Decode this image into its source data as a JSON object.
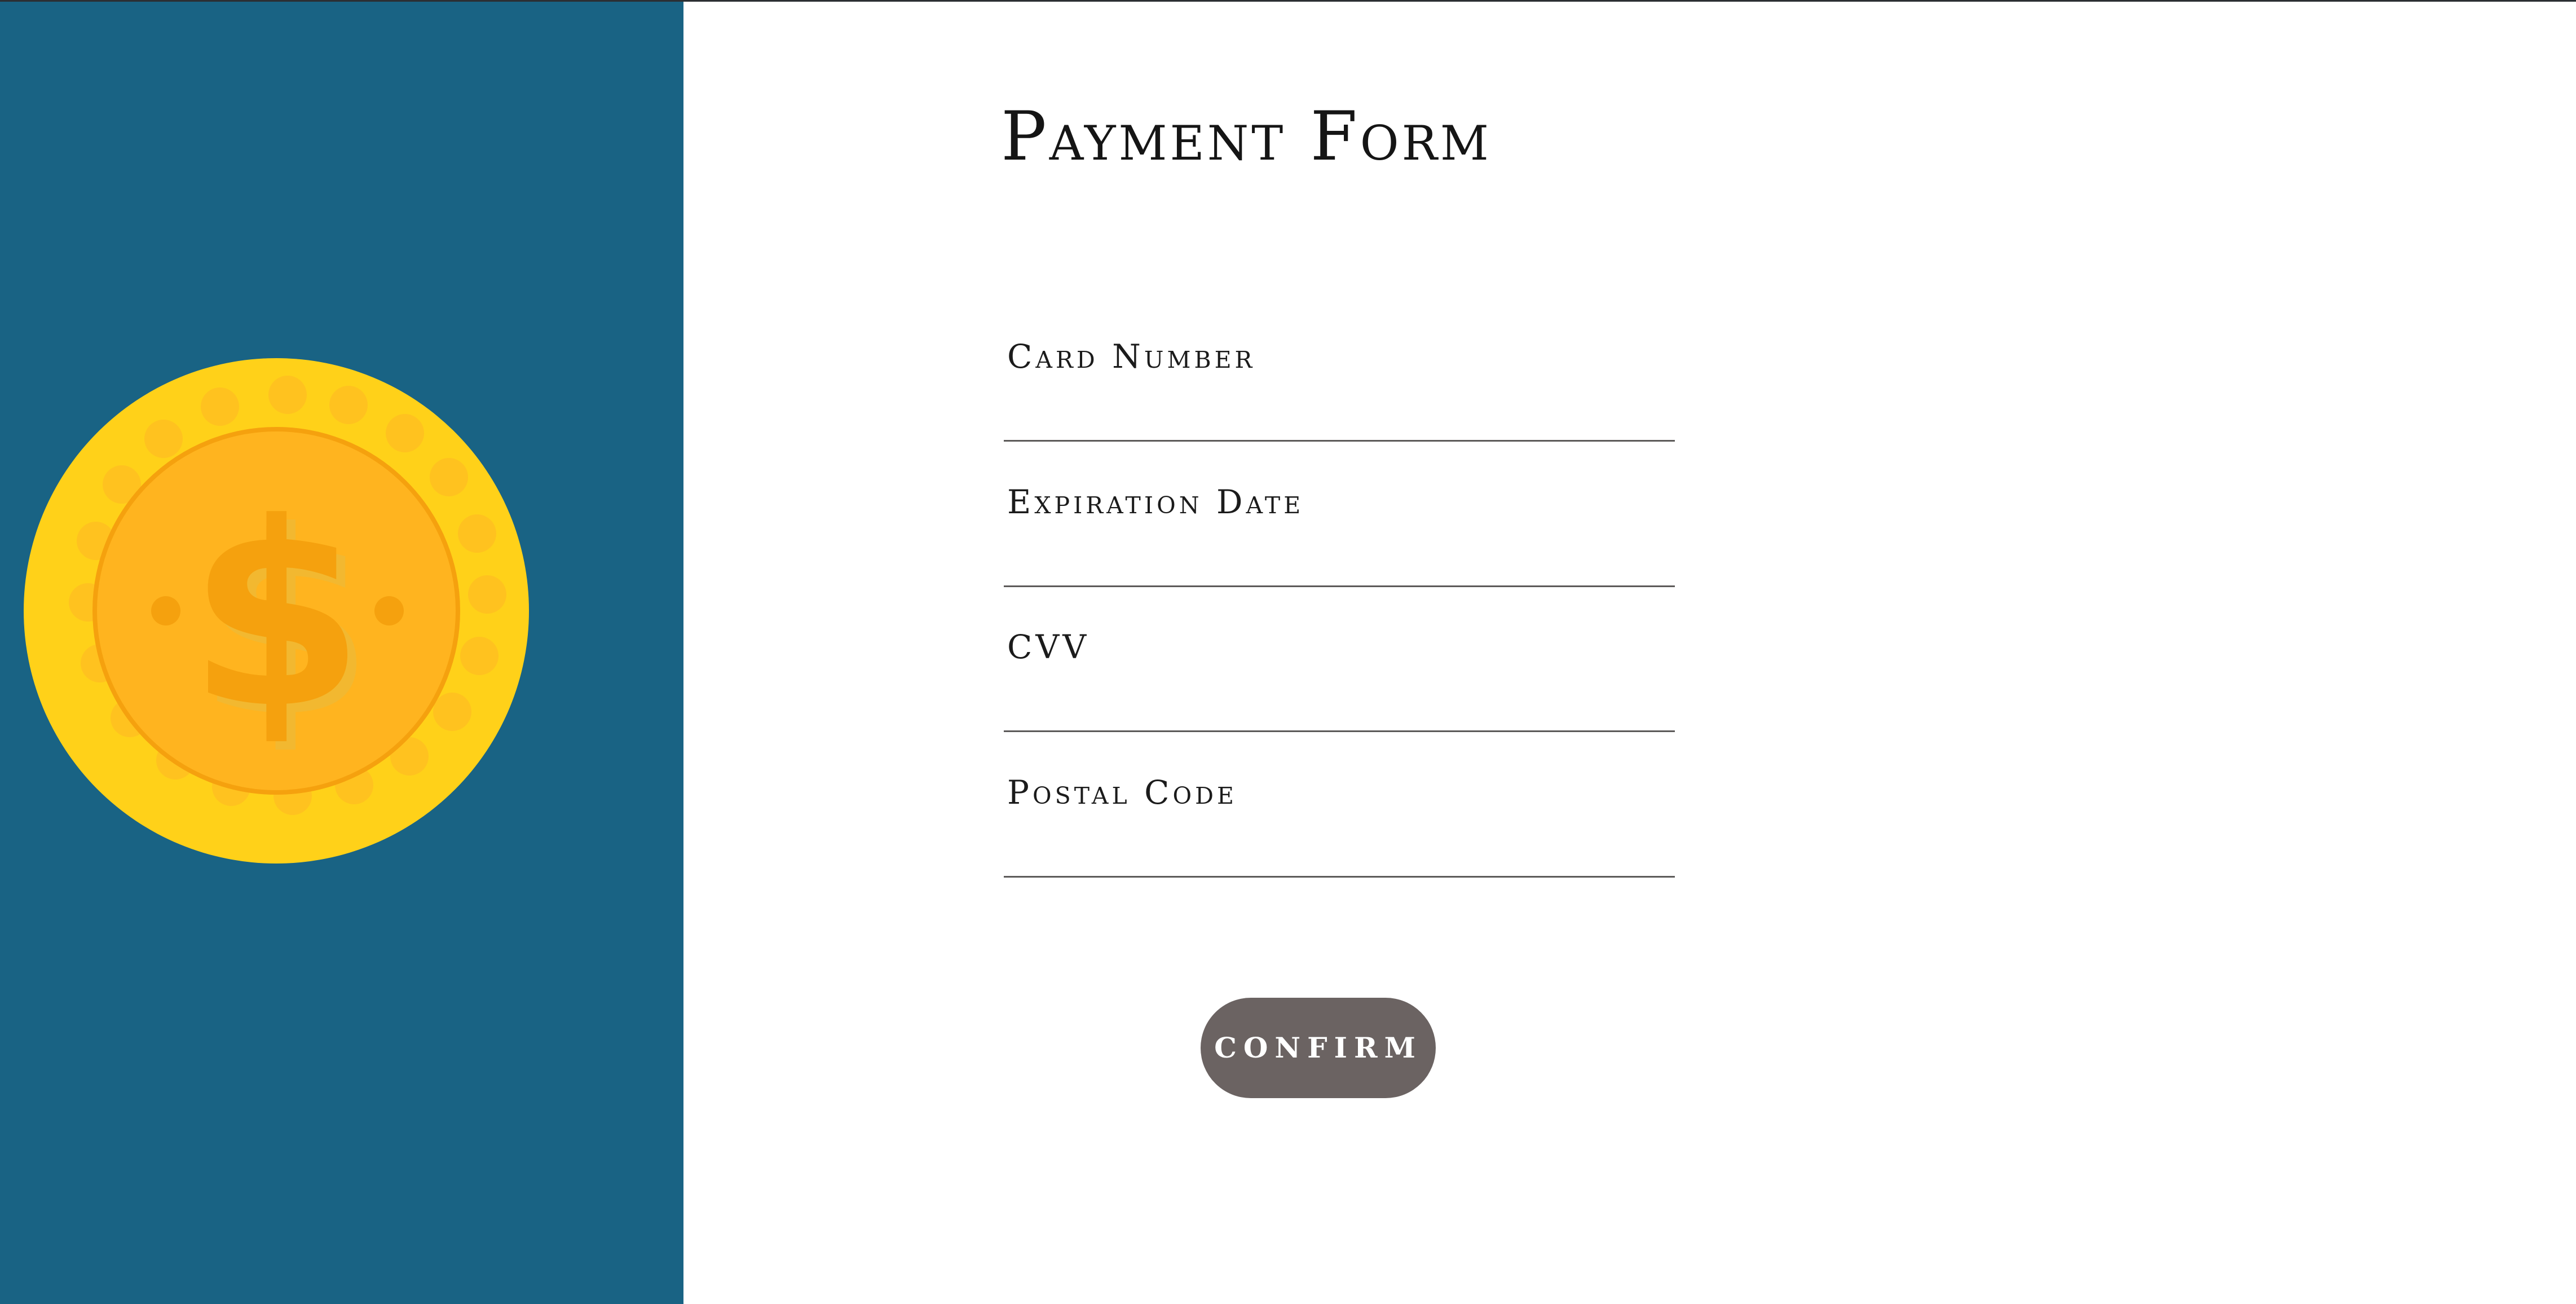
{
  "form": {
    "title": "Payment Form",
    "fields": [
      {
        "label": "Card Number",
        "value": "",
        "placeholder": ""
      },
      {
        "label": "Expiration Date",
        "value": "",
        "placeholder": ""
      },
      {
        "label": "CVV",
        "value": "",
        "placeholder": ""
      },
      {
        "label": "Postal Code",
        "value": "",
        "placeholder": ""
      }
    ],
    "confirm_label": "Confirm"
  },
  "illustration": {
    "icon": "gold-coin-dollar-icon",
    "symbol": "$"
  },
  "colors": {
    "sidebar_background": "#196384",
    "coin_outer": "#FFD119",
    "coin_inner": "#FFB41F",
    "coin_detail": "#F5A10E",
    "button_background": "#6B6362",
    "underline": "#5C5A59"
  }
}
